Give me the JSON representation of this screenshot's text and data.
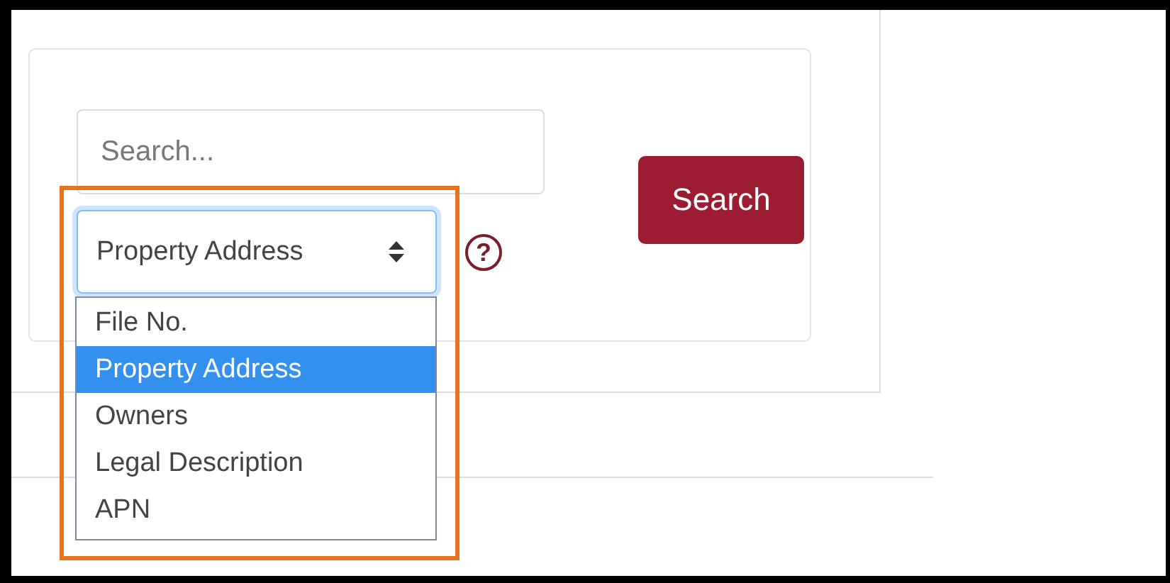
{
  "search": {
    "placeholder": "Search..."
  },
  "search_by": {
    "value": "Property Address",
    "help_icon": "?",
    "options": [
      {
        "label": "File No.",
        "selected": false
      },
      {
        "label": "Property Address",
        "selected": true
      },
      {
        "label": "Owners",
        "selected": false
      },
      {
        "label": "Legal Description",
        "selected": false
      },
      {
        "label": "APN",
        "selected": false
      }
    ]
  },
  "search_button": "Search"
}
